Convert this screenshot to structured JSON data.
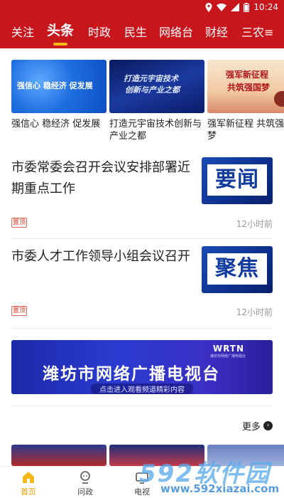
{
  "status_bar": {
    "time": "10:24"
  },
  "tabs": [
    {
      "label": "关注"
    },
    {
      "label": "头条",
      "active": true
    },
    {
      "label": "时政"
    },
    {
      "label": "民生"
    },
    {
      "label": "网络台"
    },
    {
      "label": "财经"
    },
    {
      "label": "三农≡"
    }
  ],
  "cards": [
    {
      "image_text": "强信心 稳经济 促发展",
      "caption": "强信心 稳经济 促发展"
    },
    {
      "image_text_1": "打造元宇宙技术",
      "image_text_2": "创新与产业之都",
      "caption": "打造元宇宙技术创新与产业之都"
    },
    {
      "image_text_1": "强军新征程",
      "image_text_2": "共筑强国梦",
      "caption": "强军新征程 共筑强国梦"
    }
  ],
  "news": [
    {
      "title": "市委常委会召开会议安排部署近期重点工作",
      "thumb_label": "要闻",
      "pin": "置顶",
      "time": "12小时前"
    },
    {
      "title": "市委人才工作领导小组会议召开",
      "thumb_label": "聚焦",
      "pin": "置顶",
      "time": "12小时前"
    }
  ],
  "promo": {
    "title": "潍坊市网络广播电视台",
    "subtitle": "点击进入观看频道精彩内容",
    "brand": "WRTN",
    "brand_sub": "潍坊市网络广播电视台"
  },
  "more_label": "更多",
  "bottom_nav": [
    {
      "label": "首页",
      "icon": "home-icon",
      "active": true
    },
    {
      "label": "问政",
      "icon": "inquiry-icon"
    },
    {
      "label": "电视",
      "icon": "tv-icon"
    }
  ],
  "watermark": {
    "line1": "592软件园",
    "line2": "www.592xiazai.com"
  },
  "colors": {
    "brand_red": "#c8161d",
    "accent_yellow": "#f5b91a",
    "nav_active": "#e6a100"
  }
}
